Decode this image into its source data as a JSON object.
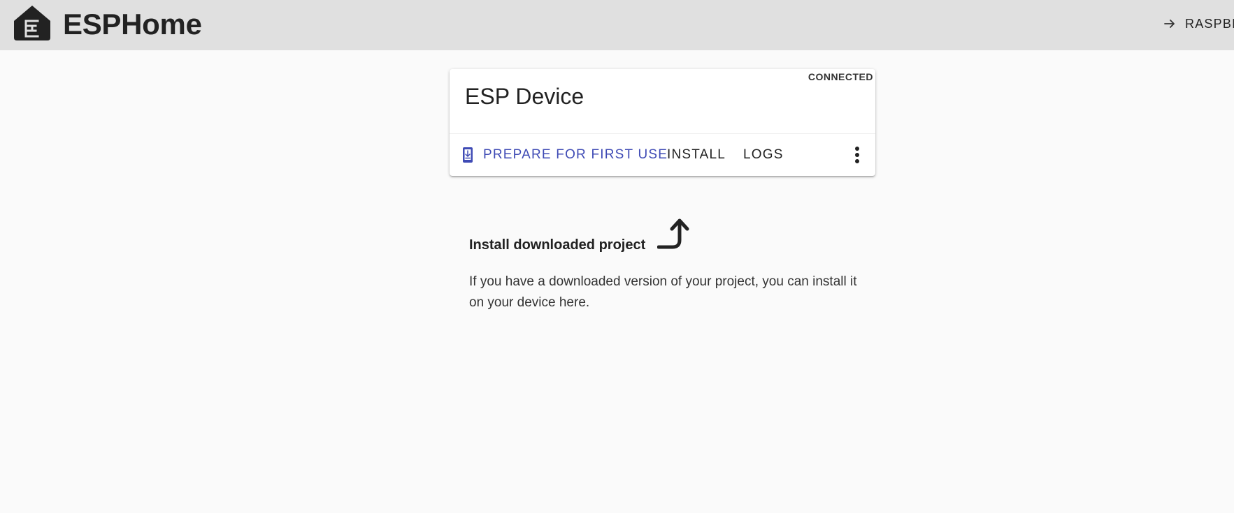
{
  "header": {
    "app_title": "ESPHome",
    "logo_icon": "esphome-logo-icon",
    "link_icon": "arrow-right-icon",
    "link_label": "RASPBI"
  },
  "card": {
    "title": "ESP Device",
    "status": "CONNECTED",
    "actions": {
      "prepare_label": "PREPARE FOR FIRST USE",
      "prepare_icon": "phone-download-icon",
      "install_label": "INSTALL",
      "logs_label": "LOGS",
      "more_icon": "more-vertical-icon"
    }
  },
  "hint": {
    "title": "Install downloaded project",
    "arrow_icon": "curved-arrow-up-icon",
    "text": "If you have a downloaded version of your project, you can install it on your device here."
  },
  "colors": {
    "header_bg": "#e0e0e0",
    "page_bg": "#fafafa",
    "accent": "#3f4bb5",
    "text": "#222222"
  }
}
